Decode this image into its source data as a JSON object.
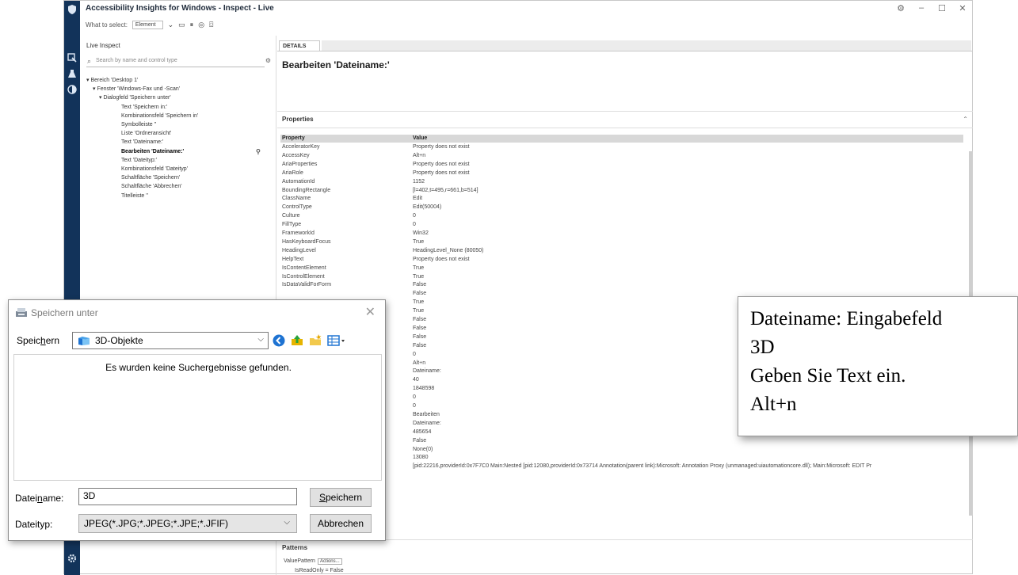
{
  "ai_window": {
    "title": "Accessibility Insights for Windows - Inspect - Live",
    "toolbar_label": "What to select:",
    "toolbar_select": "Element",
    "left_header": "Live Inspect",
    "search_placeholder": "Search by name and control type",
    "tree": [
      "Bereich 'Desktop 1'",
      "Fenster 'Windows-Fax und -Scan'",
      "Dialogfeld 'Speichern unter'",
      "Text 'Speichern in:'",
      "Kombinationsfeld 'Speichern in'",
      "Symbolleiste ''",
      "Liste 'Ordneransicht'",
      "Text 'Dateiname:'",
      "Bearbeiten 'Dateiname:'",
      "Text 'Dateityp:'",
      "Kombinationsfeld 'Dateityp'",
      "Schaltfläche 'Speichern'",
      "Schaltfläche 'Abbrechen'",
      "Titelleiste ''"
    ],
    "details_tab": "DETAILS",
    "details_heading": "Bearbeiten 'Dateiname:'",
    "properties_title": "Properties",
    "prop_col_property": "Property",
    "prop_col_value": "Value",
    "properties": [
      {
        "k": "AcceleratorKey",
        "v": "Property does not exist"
      },
      {
        "k": "AccessKey",
        "v": "Alt+n"
      },
      {
        "k": "AriaProperties",
        "v": "Property does not exist"
      },
      {
        "k": "AriaRole",
        "v": "Property does not exist"
      },
      {
        "k": "AutomationId",
        "v": "1152"
      },
      {
        "k": "BoundingRectangle",
        "v": "[l=402,t=495,r=661,b=514]"
      },
      {
        "k": "ClassName",
        "v": "Edit"
      },
      {
        "k": "ControlType",
        "v": "Edit(50004)"
      },
      {
        "k": "Culture",
        "v": "0"
      },
      {
        "k": "FillType",
        "v": "0"
      },
      {
        "k": "FrameworkId",
        "v": "Win32"
      },
      {
        "k": "HasKeyboardFocus",
        "v": "True"
      },
      {
        "k": "HeadingLevel",
        "v": "HeadingLevel_None (80050)"
      },
      {
        "k": "HelpText",
        "v": "Property does not exist"
      },
      {
        "k": "IsContentElement",
        "v": "True"
      },
      {
        "k": "IsControlElement",
        "v": "True"
      },
      {
        "k": "IsDataValidForForm",
        "v": "False"
      },
      {
        "k": "",
        "v": "False"
      },
      {
        "k": "",
        "v": "True"
      },
      {
        "k": "",
        "v": "True"
      },
      {
        "k": "",
        "v": "False"
      },
      {
        "k": "",
        "v": "False"
      },
      {
        "k": "",
        "v": "False"
      },
      {
        "k": "",
        "v": "False"
      },
      {
        "k": "",
        "v": "0"
      },
      {
        "k": "",
        "v": "Alt+n"
      },
      {
        "k": "",
        "v": "Dateiname:"
      },
      {
        "k": "",
        "v": "40"
      },
      {
        "k": "",
        "v": "1848598"
      },
      {
        "k": "",
        "v": "0"
      },
      {
        "k": "",
        "v": "0"
      },
      {
        "k": "",
        "v": "Bearbeiten"
      },
      {
        "k": "",
        "v": "Dateiname:"
      },
      {
        "k": "",
        "v": "485654"
      },
      {
        "k": "",
        "v": "False"
      },
      {
        "k": "",
        "v": "None(0)"
      },
      {
        "k": "",
        "v": "13080"
      },
      {
        "k": "",
        "v": "[pid:22216,providerId:0x7F7C0 Main:Nested [pid:12080,providerId:0x73714 Annotation(parent link):Microsoft: Annotation Proxy (unmanaged:uiautomationcore.dll); Main:Microsoft: EDIT Pr"
      }
    ],
    "patterns_title": "Patterns",
    "pattern_item": "ValuePattern",
    "pattern_actions": "Actions...",
    "pattern_sub": "IsReadOnly = False"
  },
  "dialog": {
    "title": "Speichern unter",
    "save_in_label": "Speichern",
    "save_in_mnemonic": "h",
    "save_in_label_tail": "ern",
    "location": "3D-Objekte",
    "empty_message": "Es wurden keine Suchergebnisse gefunden.",
    "filename_label_pre": "Datei",
    "filename_label_mnemonic": "n",
    "filename_label_post": "ame:",
    "filename_value": "3D",
    "filetype_label": "Dateityp:",
    "filetype_value": "JPEG(*.JPG;*.JPEG;*.JPE;*.JFIF)",
    "save_button_mnemonic": "S",
    "save_button_rest": "peichern",
    "cancel_button": "Abbrechen"
  },
  "speech": {
    "lines": [
      "Dateiname: Eingabefeld",
      "3D",
      "Geben Sie Text ein.",
      "Alt+n"
    ]
  },
  "colors": {
    "rail": "#12335a",
    "accent_blue": "#1e73d2"
  }
}
